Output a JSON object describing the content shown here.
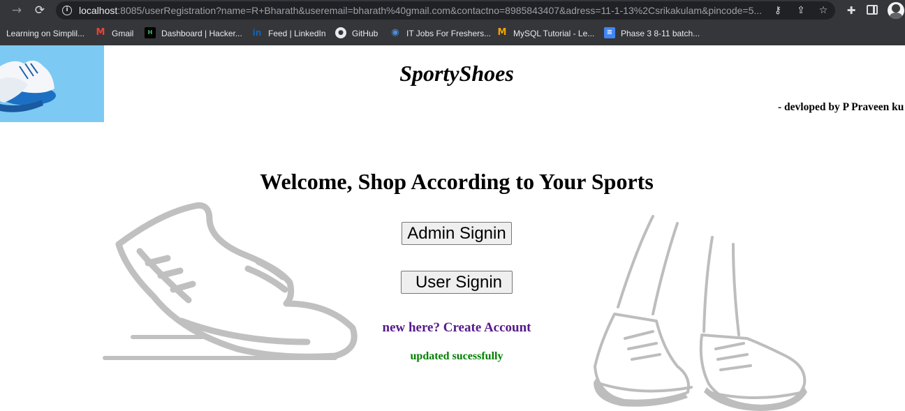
{
  "browser": {
    "url_host": "localhost",
    "url_rest": ":8085/userRegistration?name=R+Bharath&useremail=bharath%40gmail.com&contactno=8985843407&adress=11-1-13%2Csrikakulam&pincode=5...",
    "bookmarks": [
      {
        "label": "Learning on Simplil...",
        "icon": "none"
      },
      {
        "label": "Gmail",
        "icon": "gmail-icon"
      },
      {
        "label": "Dashboard | Hacker...",
        "icon": "hackerrank-icon"
      },
      {
        "label": "Feed | LinkedIn",
        "icon": "linkedin-icon"
      },
      {
        "label": "GitHub",
        "icon": "github-icon"
      },
      {
        "label": "IT Jobs For Freshers...",
        "icon": "globe-icon"
      },
      {
        "label": "MySQL Tutorial - Le...",
        "icon": "mysql-icon"
      },
      {
        "label": "Phase 3 8-11 batch...",
        "icon": "docs-icon"
      }
    ]
  },
  "page": {
    "brand": "SportyShoes",
    "developer_credit": "- devloped by P Praveen ku",
    "welcome_heading": "Welcome, Shop According to Your Sports",
    "admin_signin_label": "Admin Signin",
    "user_signin_label": "User Signin",
    "create_account_link": "new here? Create Account",
    "status_message": "updated sucessfully"
  },
  "colors": {
    "chrome_bg": "#35363a",
    "omnibox_bg": "#202124",
    "banner_bg": "#7ccaf3",
    "link": "#551a8b",
    "success": "#008000",
    "illustration": "#c0c0c0"
  }
}
